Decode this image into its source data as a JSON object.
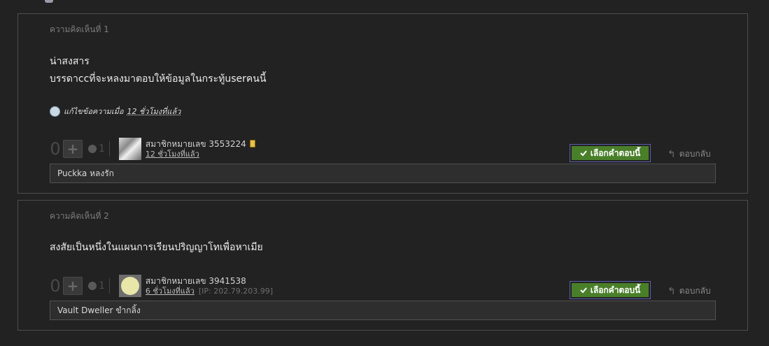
{
  "comments": [
    {
      "label": "ความคิดเห็นที่ 1",
      "body_lines": [
        "น่าสงสาร",
        "บรรดาccที่จะหลงมาตอบให้ข้อมูลในกระทู้userคนนี้"
      ],
      "edit_prefix": "แก้ไขข้อความเมื่อ",
      "edit_time": "12 ชั่วโมงที่แล้ว",
      "score": "0",
      "emotion_count": "1",
      "member": "สมาชิกหมายเลข 3553224",
      "time": "12 ชั่วโมงที่แล้ว",
      "ip": "",
      "select_label": "เลือกคำตอบนี้",
      "reply_label": "ตอบกลับ",
      "sub_comment": "Puckka หลงรัก"
    },
    {
      "label": "ความคิดเห็นที่ 2",
      "body_lines": [
        "สงสัยเป็นหนึ่งในแผนการเรียนปริญญาโทเพื่อหาเมีย"
      ],
      "score": "0",
      "emotion_count": "1",
      "member": "สมาชิกหมายเลข 3941538",
      "time": "6 ชั่วโมงที่แล้ว",
      "ip": "[IP: 202.79.203.99]",
      "select_label": "เลือกคำตอบนี้",
      "reply_label": "ตอบกลับ",
      "sub_comment": "Vault Dweller ขำกลิ้ง"
    }
  ],
  "icons": {
    "edit": "edit-history-icon",
    "plus": "plus-icon",
    "emotion": "emotion-icon",
    "mobile": "mobile-phone-icon",
    "check": "check-icon",
    "reply": "reply-arrow-icon"
  },
  "colors": {
    "background": "#232222",
    "select_button": "#4a7f2a",
    "select_border": "#5a5fb0"
  }
}
